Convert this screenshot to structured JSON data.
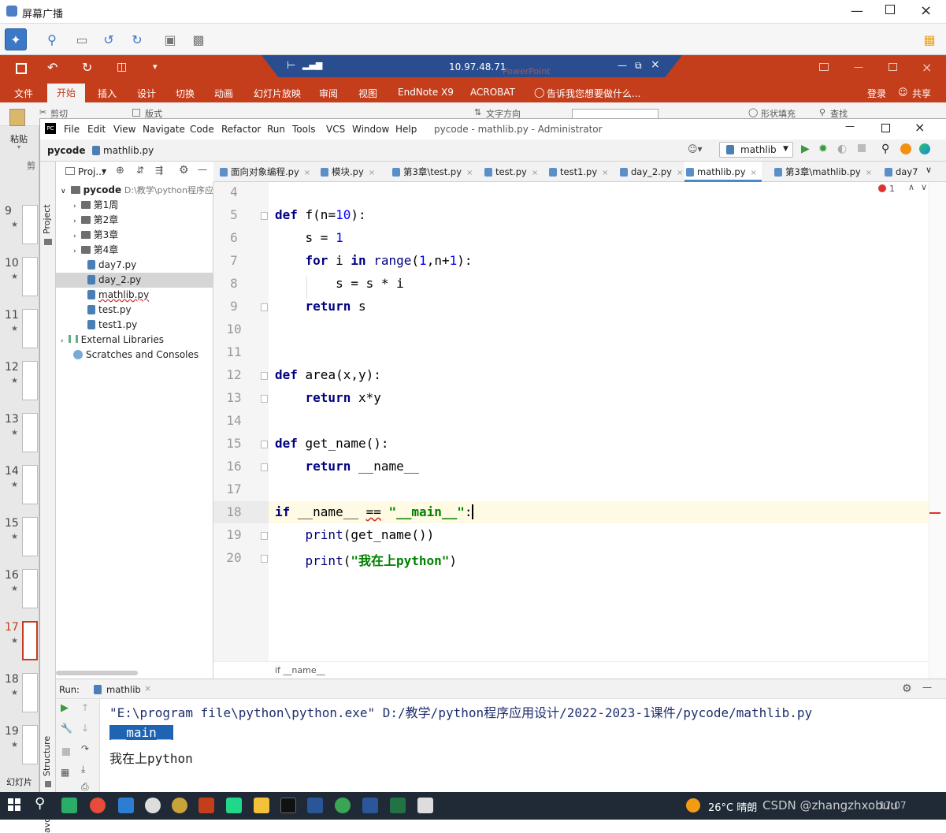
{
  "broadcast": {
    "title": "屏幕广播"
  },
  "ppt": {
    "remote_ip": "10.97.48.71",
    "remote_ghost": "PowerPoint",
    "menu": [
      "文件",
      "开始",
      "插入",
      "设计",
      "切换",
      "动画",
      "幻灯片放映",
      "审阅",
      "视图",
      "EndNote X9",
      "ACROBAT"
    ],
    "tell_me": "告诉我您想要做什么...",
    "login": "登录",
    "share": "共享",
    "ribbon": {
      "paste": "粘贴",
      "cut": "剪切",
      "layout": "版式",
      "text_direction": "文字方向",
      "shape_fill": "形状填充",
      "find": "查找",
      "clip": "剪"
    },
    "slides": [
      "9",
      "10",
      "11",
      "12",
      "13",
      "14",
      "15",
      "16",
      "17",
      "18",
      "19"
    ],
    "star": "★",
    "status_label": "幻灯片"
  },
  "pycharm": {
    "menu": [
      "File",
      "Edit",
      "View",
      "Navigate",
      "Code",
      "Refactor",
      "Run",
      "Tools",
      "VCS",
      "Window",
      "Help"
    ],
    "title": "pycode - mathlib.py - Administrator",
    "crumb_project": "pycode",
    "crumb_file": "mathlib.py",
    "run_config": "mathlib",
    "side_left": {
      "project": "Project",
      "structure": "Structure",
      "favorites": "avorites"
    },
    "project_panel": {
      "label": "Proj..."
    },
    "tree": {
      "root": "pycode",
      "root_path": "D:\\教学\\python程序应",
      "folders": [
        "第1周",
        "第2章",
        "第3章",
        "第4章"
      ],
      "files": [
        "day7.py",
        "day_2.py",
        "mathlib.py",
        "test.py",
        "test1.py"
      ],
      "libs": "External Libraries",
      "scratches": "Scratches and Consoles"
    },
    "tabs": [
      "面向对象编程.py",
      "模块.py",
      "第3章\\test.py",
      "test.py",
      "test1.py",
      "day_2.py",
      "mathlib.py",
      "第3章\\mathlib.py",
      "day7"
    ],
    "active_tab": "mathlib.py",
    "error_count": "1",
    "line_numbers": [
      "4",
      "5",
      "6",
      "7",
      "8",
      "9",
      "10",
      "11",
      "12",
      "13",
      "14",
      "15",
      "16",
      "17",
      "18",
      "19",
      "20"
    ],
    "code": {
      "l5a": "def",
      "l5b": " f(n=",
      "l5c": "10",
      "l5d": "):",
      "l6a": "    s = ",
      "l6b": "1",
      "l7a": "    for",
      "l7b": " i ",
      "l7c": "in",
      "l7d": " range",
      "l7e": "(",
      "l7f": "1",
      "l7g": ",n+",
      "l7h": "1",
      "l7i": "):",
      "l8": "        s = s * i",
      "l9a": "    return",
      "l9b": " s",
      "l12a": "def",
      "l12b": " area(x,y):",
      "l13a": "    return",
      "l13b": " x*y",
      "l15a": "def",
      "l15b": " get_name():",
      "l16a": "    return",
      "l16b": " __name__",
      "l18a": "if",
      "l18b": " __name__ ",
      "l18c": "==",
      "l18d": " ",
      "l18e": "\"__main__\"",
      "l18f": ":",
      "l19a": "    print",
      "l19b": "(get_name())",
      "l20a": "    print",
      "l20b": "(",
      "l20c": "\"我在上python\"",
      "l20d": ")"
    },
    "breadcrumb": "if __name__",
    "run": {
      "label": "Run:",
      "config": "mathlib",
      "cmd": "\"E:\\program file\\python\\python.exe\" D:/教学/python程序应用设计/2022-2023-1课件/pycode/mathlib.py",
      "out1": "__main__",
      "out2": "我在上python"
    }
  },
  "taskbar": {
    "weather": "26°C 晴朗",
    "tray_text": "CSDN @zhangzhxobuu",
    "clock": "17:07"
  }
}
